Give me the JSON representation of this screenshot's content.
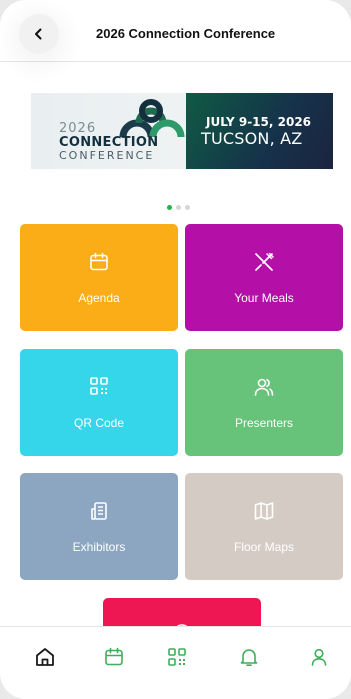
{
  "header": {
    "title": "2026 Connection Conference",
    "back_icon": "chevron-left-icon"
  },
  "banner": {
    "year": "2026",
    "name": "CONNECTION",
    "sub": "CONFERENCE",
    "date": "JULY 9-15, 2026",
    "city": "TUCSON, AZ"
  },
  "carousel": {
    "pages": 3,
    "active": 1
  },
  "tiles": [
    {
      "label": "Agenda",
      "icon": "calendar-icon",
      "color": "#fbad17"
    },
    {
      "label": "Your Meals",
      "icon": "utensils-crossed-icon",
      "color": "#b40fa6"
    },
    {
      "label": "QR Code",
      "icon": "qr-code-icon",
      "color": "#35d6e9"
    },
    {
      "label": "Presenters",
      "icon": "users-icon",
      "color": "#67c27a"
    },
    {
      "label": "Exhibitors",
      "icon": "building-icon",
      "color": "#8ca5c0"
    },
    {
      "label": "Floor Maps",
      "icon": "map-icon",
      "color": "#d4cbc4"
    }
  ],
  "tabbar": {
    "items": [
      {
        "icon": "home-icon",
        "active": true
      },
      {
        "icon": "calendar-icon",
        "active": false
      },
      {
        "icon": "qr-code-icon",
        "active": false
      },
      {
        "icon": "bell-icon",
        "active": false
      },
      {
        "icon": "user-icon",
        "active": false
      }
    ],
    "active_color": "#1a1a1a",
    "inactive_color": "#3fae5a"
  }
}
